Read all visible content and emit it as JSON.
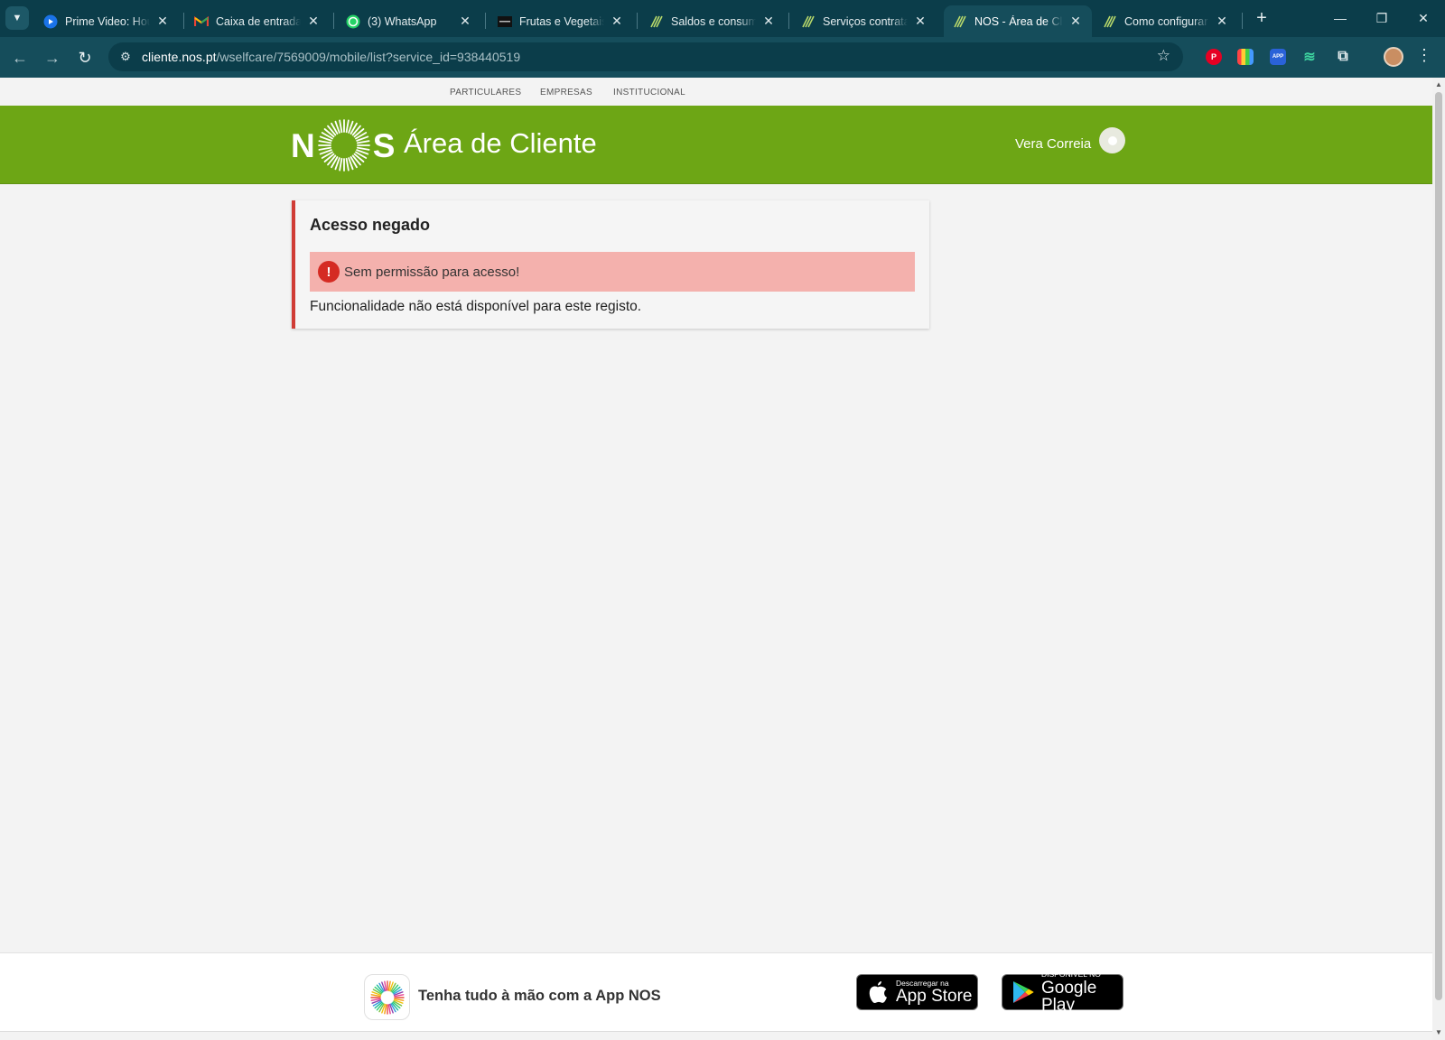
{
  "browser": {
    "tabs": [
      {
        "title": "Prime Video: House",
        "icon": "prime-video-icon",
        "active": false
      },
      {
        "title": "Caixa de entrada (",
        "icon": "gmail-icon",
        "active": false
      },
      {
        "title": "(3) WhatsApp",
        "icon": "whatsapp-icon",
        "active": false
      },
      {
        "title": "Frutas e Vegetais |",
        "icon": "site-icon",
        "active": false
      },
      {
        "title": "Saldos e consumos",
        "icon": "nos-icon",
        "active": false
      },
      {
        "title": "Serviços contratados",
        "icon": "nos-icon",
        "active": false
      },
      {
        "title": "NOS - Área de Cliente",
        "icon": "nos-icon",
        "active": true
      },
      {
        "title": "Como configurar o",
        "icon": "nos-icon",
        "active": false
      }
    ],
    "url_host": "cliente.nos.pt",
    "url_path": "/wselfcare/7569009/mobile/list?service_id=938440519"
  },
  "topnav": {
    "items": [
      "PARTICULARES",
      "EMPRESAS",
      "INSTITUCIONAL"
    ]
  },
  "header": {
    "logo_left": "N",
    "logo_right": "S",
    "title": "Área de Cliente",
    "user_name": "Vera Correia",
    "brand_color": "#6da615"
  },
  "error_card": {
    "title": "Acesso negado",
    "alert_icon": "!",
    "alert_text": "Sem permissão para acesso!",
    "description": "Funcionalidade não está disponível para este registo.",
    "accent_color": "#d03c35",
    "alert_bg": "#f4b1ad"
  },
  "footer": {
    "promo": "Tenha tudo à mão com a App NOS",
    "app_store_small": "Descarregar na",
    "app_store_big": "App Store",
    "google_play_small": "DISPONÍVEL NO",
    "google_play_big": "Google Play"
  }
}
